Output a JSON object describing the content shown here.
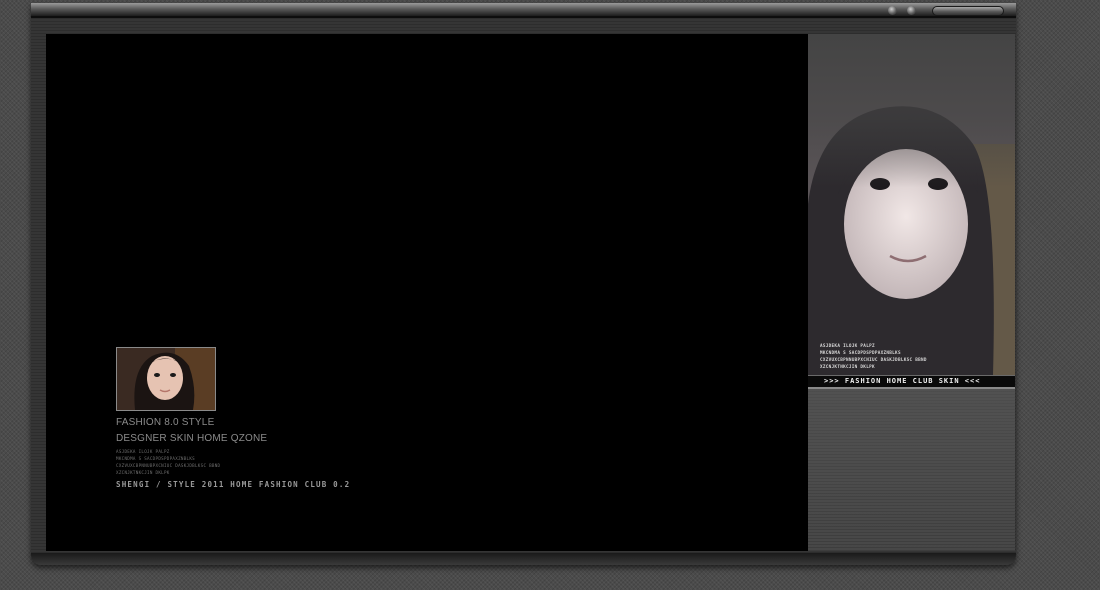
{
  "window": {
    "controls": [
      "minimize-button",
      "close-button"
    ]
  },
  "main": {
    "title_line1": "FASHION 8.0 STYLE",
    "title_line2": "DESGNER SKIN HOME QZONE",
    "micro_lines": [
      "ASJDEKA  ILOJK PALPZ",
      "MKCNDMA  S SACDPDSPDPAXZNBLKS",
      "CXZVUXCBPNNUBPXCNIUC DASKJDBLKSC  BBND",
      "XZCNJKTNKCJIN DKLPK"
    ],
    "tagline": "SHENGI / STYLE 2011 HOME FASHION CLUB 0.2"
  },
  "side": {
    "micro_lines": [
      "ASJDEKA  ILOJK PALPZ",
      "MKCNDMA  S SACDPDSPDPAXZNBLKS",
      "CXZVUXCBPNNUBPXCNIUC DASKJDBLKSC  BBND",
      "XZCNJKTNKCJIN DKLPK"
    ],
    "banner": ">>> FASHION HOME CLUB SKIN <<<"
  }
}
